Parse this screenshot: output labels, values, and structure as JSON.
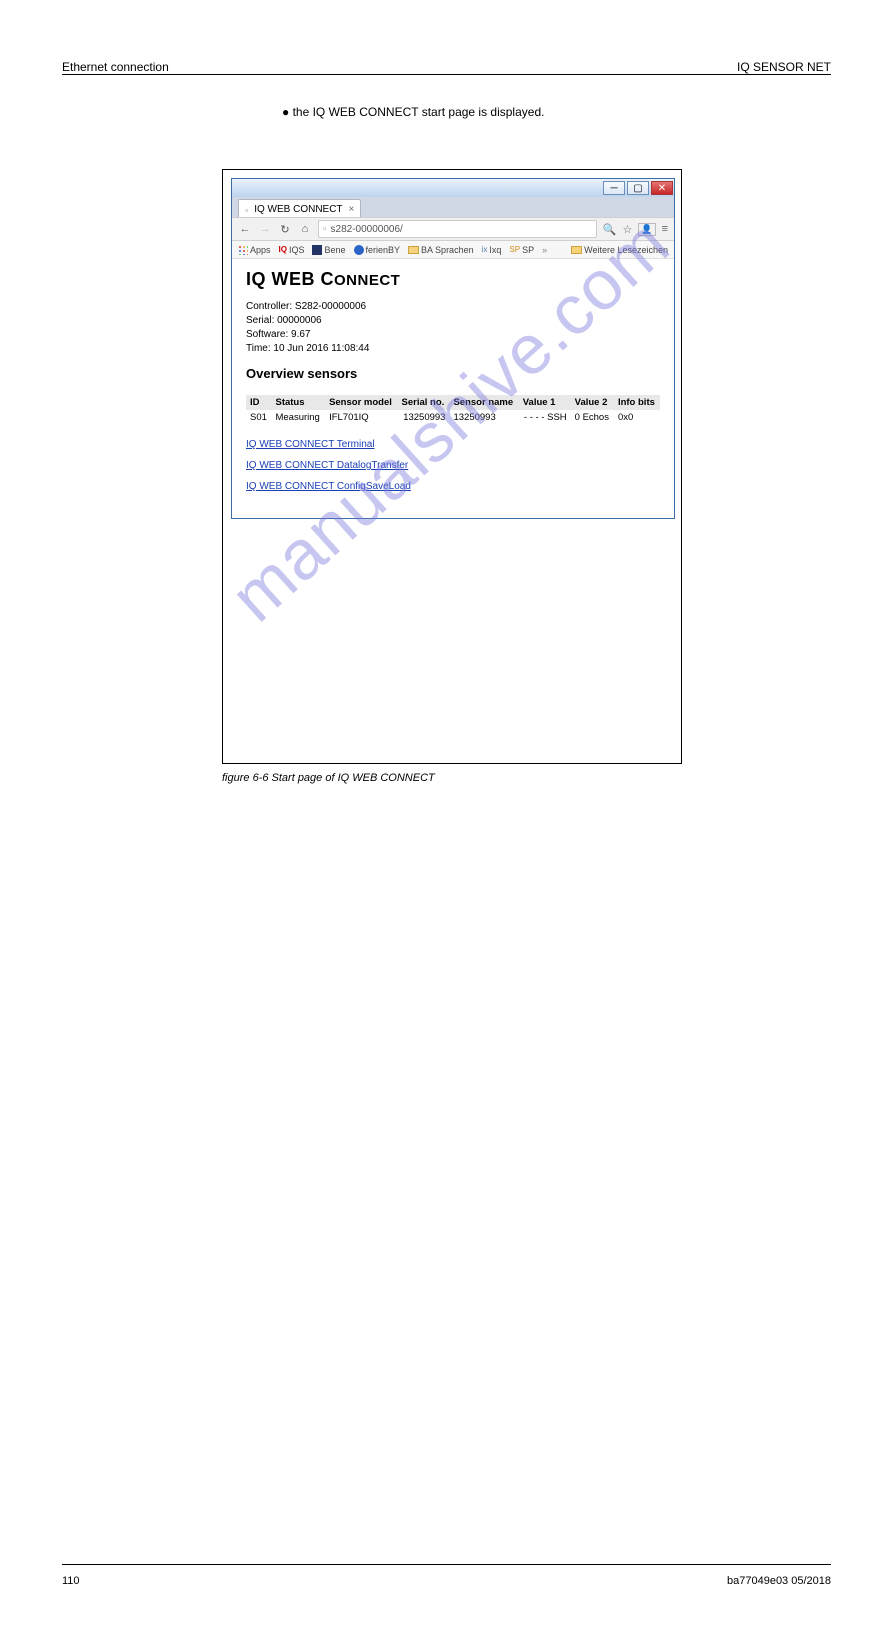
{
  "doc_header": {
    "left": "Ethernet connection",
    "right": "IQ SENSOR NET"
  },
  "section_line": "● the IQ WEB CONNECT start page is displayed.",
  "figure_label": "figure 6-6 Start page of IQ WEB CONNECT",
  "footer": {
    "left": "110",
    "right": "ba77049e03    05/2018"
  },
  "browser": {
    "tab": {
      "title": "IQ WEB CONNECT"
    },
    "nav": {
      "url": "s282-00000006/"
    },
    "bookmarks": {
      "apps": "Apps",
      "iqs": "IQS",
      "bene": "Bene",
      "ferien": "ferienBY",
      "ba": "BA Sprachen",
      "ixq": "Ixq",
      "sp": "SP",
      "more": "»",
      "other": "Weitere Lesezeichen"
    }
  },
  "page": {
    "title_main": "IQ WEB C",
    "title_rest": "ONNECT",
    "meta": {
      "controller": "Controller: S282-00000006",
      "serial": "Serial: 00000006",
      "software": "Software: 9.67",
      "time": "Time: 10 Jun 2016 11:08:44"
    },
    "overview_heading": "Overview sensors",
    "table": {
      "headers": {
        "id": "ID",
        "status": "Status",
        "model": "Sensor model",
        "serial": "Serial no.",
        "name": "Sensor name",
        "v1": "Value 1",
        "v2": "Value 2",
        "info": "Info bits"
      },
      "row": {
        "id": "S01",
        "status": "Measuring",
        "model": "IFL701IQ",
        "serial": "13250993",
        "name": "13250993",
        "v1": "- - - -  SSH",
        "v2": "0   Echos",
        "info": "0x0"
      }
    },
    "links": {
      "terminal": "IQ WEB CONNECT Terminal",
      "datalog": "IQ WEB CONNECT DatalogTransfer",
      "config": "IQ WEB CONNECT ConfigSaveLoad"
    }
  },
  "watermark": "manualshive.com"
}
